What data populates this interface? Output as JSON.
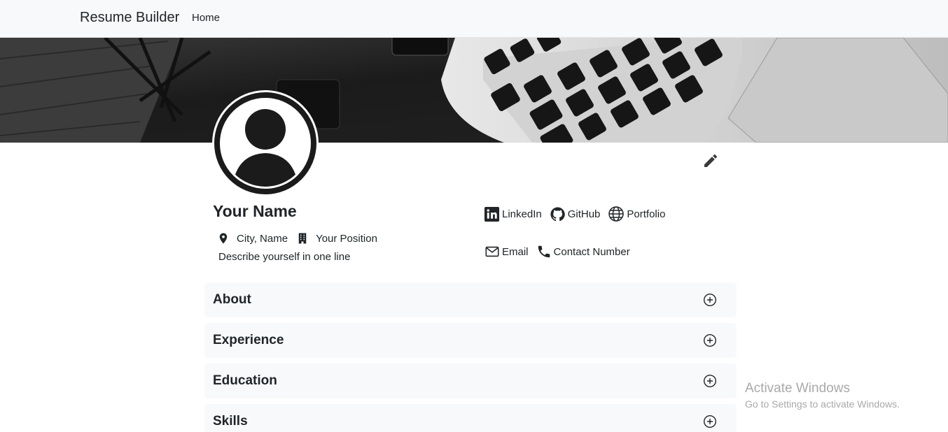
{
  "navbar": {
    "brand": "Resume Builder",
    "links": [
      "Home"
    ]
  },
  "profile": {
    "name": "Your Name",
    "location": "City, Name",
    "position": "Your Position",
    "tagline": "Describe yourself in one line"
  },
  "links": {
    "linkedin": "LinkedIn",
    "github": "GitHub",
    "portfolio": "Portfolio",
    "email": "Email",
    "contact": "Contact Number"
  },
  "sections": [
    "About",
    "Experience",
    "Education",
    "Skills"
  ],
  "icons": {
    "edit": "pencil-icon",
    "location": "map-pin-icon",
    "position": "building-icon",
    "linkedin": "linkedin-icon",
    "github": "github-icon",
    "portfolio": "globe-icon",
    "email": "envelope-icon",
    "contact": "phone-icon",
    "section_toggle": "plus-circle-icon"
  },
  "watermark": {
    "title": "Activate Windows",
    "subtitle": "Go to Settings to activate Windows."
  },
  "colors": {
    "navbar_bg": "#f8f9fa",
    "text": "#212529",
    "section_bg": "#f8f9fa",
    "cover_dark": "#1e1e1e",
    "watermark": "#a9a9a9"
  }
}
